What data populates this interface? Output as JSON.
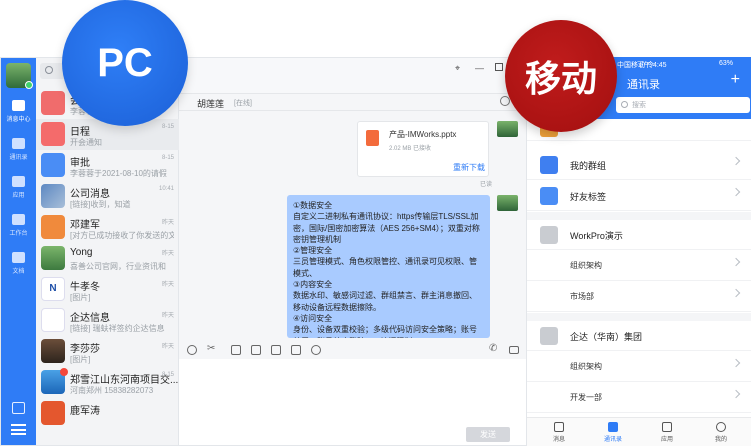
{
  "badges": {
    "pc": "PC",
    "mobile": "移动"
  },
  "pc": {
    "rail": {
      "items": [
        {
          "label": "消息中心",
          "icon": "chat-bubble-icon",
          "active": true
        },
        {
          "label": "通讯录",
          "icon": "contacts-icon"
        },
        {
          "label": "应用",
          "icon": "apps-grid-icon"
        },
        {
          "label": "工作台",
          "icon": "folder-icon"
        },
        {
          "label": "文档",
          "icon": "document-icon"
        }
      ]
    },
    "conversations": [
      {
        "name": "会",
        "snippet": "李蓉蓉分享了...",
        "time": ""
      },
      {
        "name": "日程",
        "snippet": "开会通知",
        "time": "8-15"
      },
      {
        "name": "审批",
        "snippet": "李蓉蓉于2021-08-10的请假",
        "time": "8-15"
      },
      {
        "name": "公司消息",
        "snippet": "[链接]收到，知道",
        "time": "10:41"
      },
      {
        "name": "邓建军",
        "snippet": "[对方已成功接收了你发送的文件]",
        "time": "昨天"
      },
      {
        "name": "Yong",
        "snippet": "喜善公司官网，行业资讯和",
        "time": "昨天"
      },
      {
        "name": "牛孝冬",
        "snippet": "[图片]",
        "time": "昨天"
      },
      {
        "name": "企达信息",
        "snippet": "[链接] 瑞蚨祥签约企达信息",
        "time": "昨天"
      },
      {
        "name": "李莎莎",
        "snippet": "[图片]",
        "time": "昨天"
      },
      {
        "name": "郑雪江山东河南项目交...",
        "snippet": "河南郑州 15838282073",
        "time": "8-15"
      },
      {
        "name": "鹿军涛",
        "snippet": "",
        "time": ""
      }
    ],
    "chat": {
      "title": "胡莲莲",
      "status": "[在线]",
      "file": {
        "name": "产品-IMWorks.pptx",
        "meta": "2.02 MB  已接收",
        "action": "重新下载"
      },
      "read_state": "已读",
      "message_lines": [
        "①数据安全",
        "自定义二进制私有通讯协议：https传输层TLS/SSL加密，国际/国密加密算法（AES 256+SM4）；双重对称密钥管理机制",
        "②管理安全",
        "三员管理模式、角色权限管控、通讯录可见权限、管模式、",
        "③内容安全",
        "数据水印、敏感词过滤、群组禁言、群主消息撤回、移动设备远程数据擦除。",
        "④访问安全",
        "身份、设备双重校验；多级代码访问安全策略；账号禁用、账号禁止登陆、IP访问限制。"
      ],
      "send_label": "发送"
    }
  },
  "mobile": {
    "status_left": "中国移动 令",
    "status_time": "下午 4:45",
    "status_right": "63%",
    "title": "通讯录",
    "search_placeholder": "搜索",
    "rows": [
      {
        "label": "我的群组",
        "icon": "group-icon"
      },
      {
        "label": "好友标签",
        "icon": "tag-icon"
      },
      {
        "label": "WorkPro演示",
        "icon": "org-icon"
      },
      {
        "label": "组织架构"
      },
      {
        "label": "市场部"
      },
      {
        "label": "企达（华南）集团",
        "icon": "org-icon"
      },
      {
        "label": "组织架构"
      },
      {
        "label": "开发一部"
      }
    ],
    "tabs": [
      {
        "label": "消息",
        "icon": "message-icon"
      },
      {
        "label": "通讯录",
        "icon": "contacts-icon",
        "active": true
      },
      {
        "label": "应用",
        "icon": "apps-icon"
      },
      {
        "label": "我的",
        "icon": "profile-icon"
      }
    ]
  },
  "colors": {
    "pc_blue": "#2f7cf6",
    "mobile_red": "#b51414",
    "bubble": "#a9cbff"
  }
}
